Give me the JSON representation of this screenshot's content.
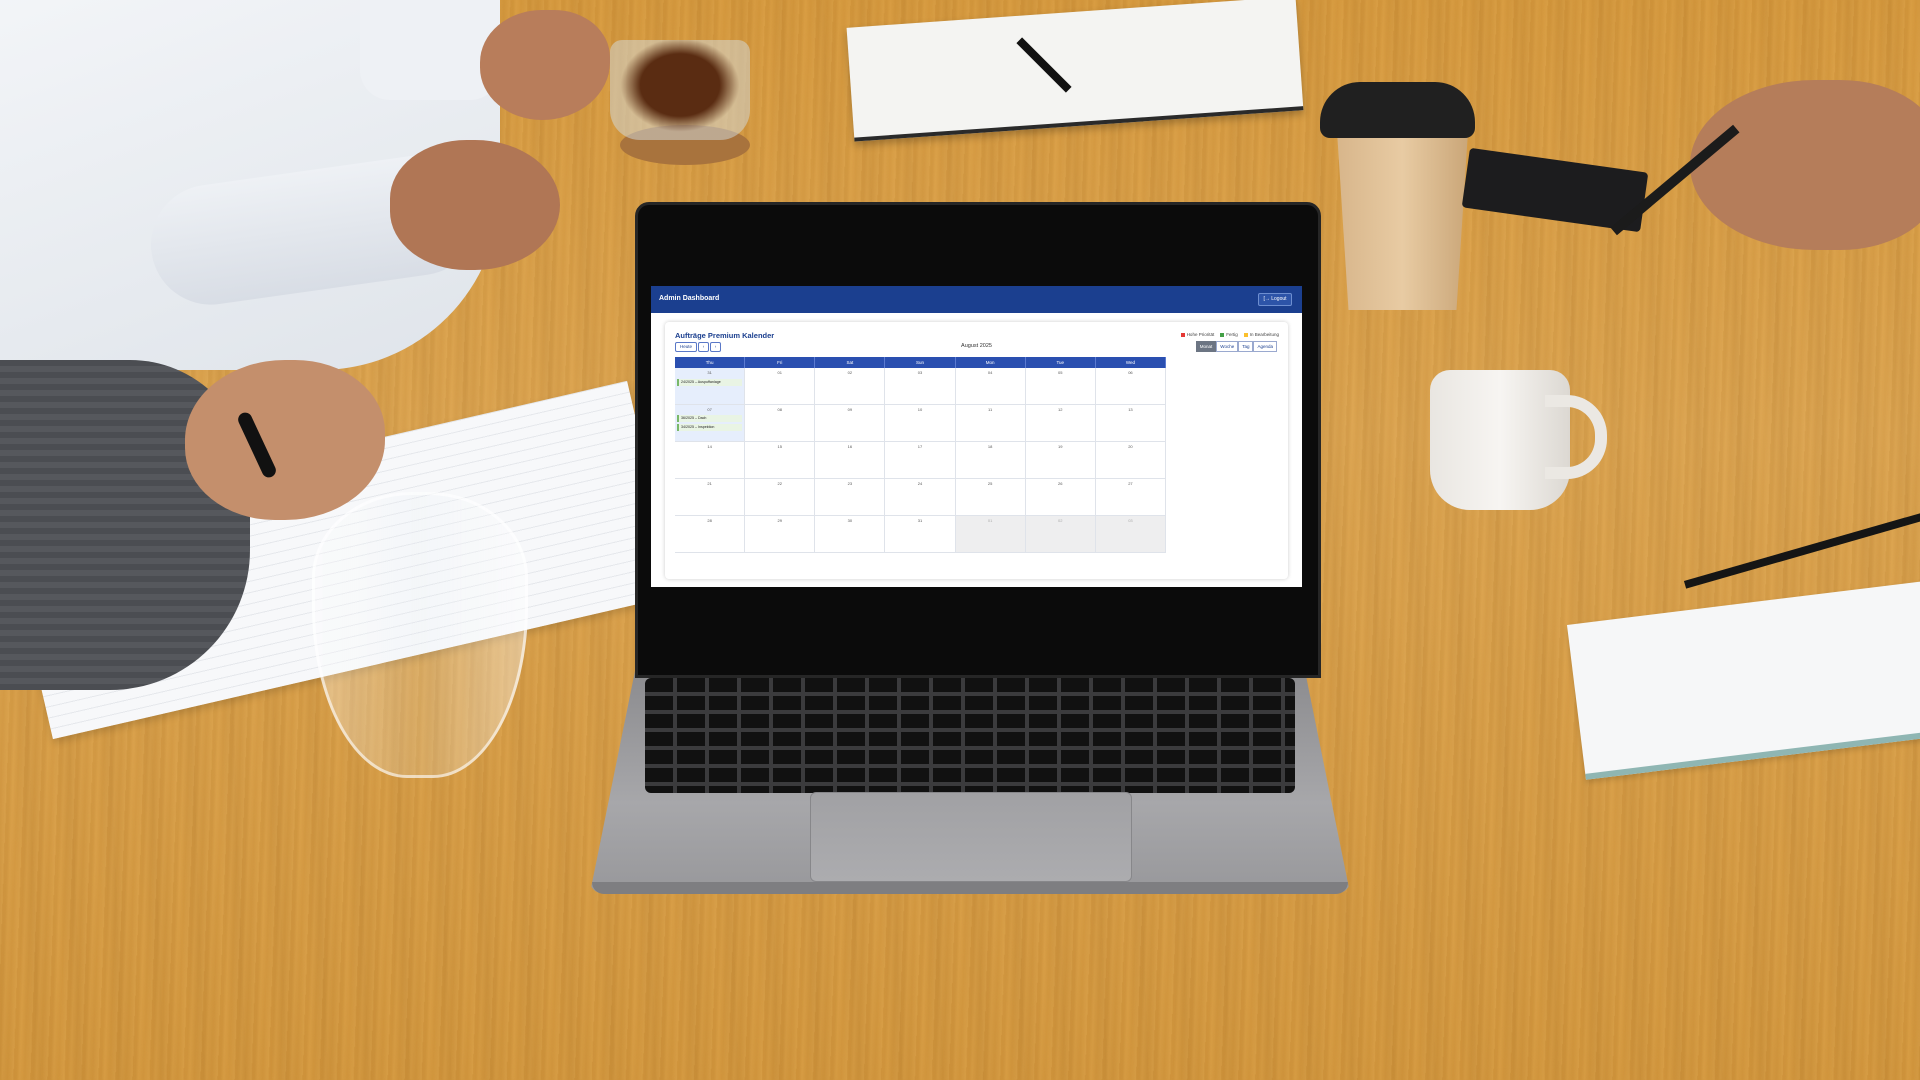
{
  "app": {
    "title": "Admin Dashboard",
    "logout_label": "[→ Logout"
  },
  "calendar": {
    "title": "Aufträge Premium Kalender",
    "legend": [
      {
        "label": "Hohe Priorität",
        "color": "#e53935"
      },
      {
        "label": "Fertig",
        "color": "#43a047"
      },
      {
        "label": "In Bearbeitung",
        "color": "#fbc02d"
      }
    ],
    "nav": {
      "today": "Heute",
      "prev": "‹",
      "next": "›"
    },
    "month_label": "August 2025",
    "views": [
      "Monat",
      "Woche",
      "Tag",
      "Agenda"
    ],
    "active_view": "Monat",
    "weekdays": [
      "Thu",
      "Fri",
      "Sat",
      "Sun",
      "Mon",
      "Tue",
      "Wed"
    ],
    "weeks": [
      [
        "31",
        "01",
        "02",
        "03",
        "04",
        "05",
        "06"
      ],
      [
        "07",
        "08",
        "09",
        "10",
        "11",
        "12",
        "13"
      ],
      [
        "14",
        "15",
        "16",
        "17",
        "18",
        "19",
        "20"
      ],
      [
        "21",
        "22",
        "23",
        "24",
        "25",
        "26",
        "27"
      ],
      [
        "28",
        "29",
        "30",
        "31",
        "01",
        "02",
        "03"
      ]
    ],
    "events": [
      {
        "label": "24/2025 – Auspuffanlage"
      },
      {
        "label": "36/2025 – Dach"
      },
      {
        "label": "34/2025 – Inspektion"
      }
    ]
  },
  "colors": {
    "header": "#1b3f8f",
    "weekday_bar": "#2a4fb0"
  }
}
